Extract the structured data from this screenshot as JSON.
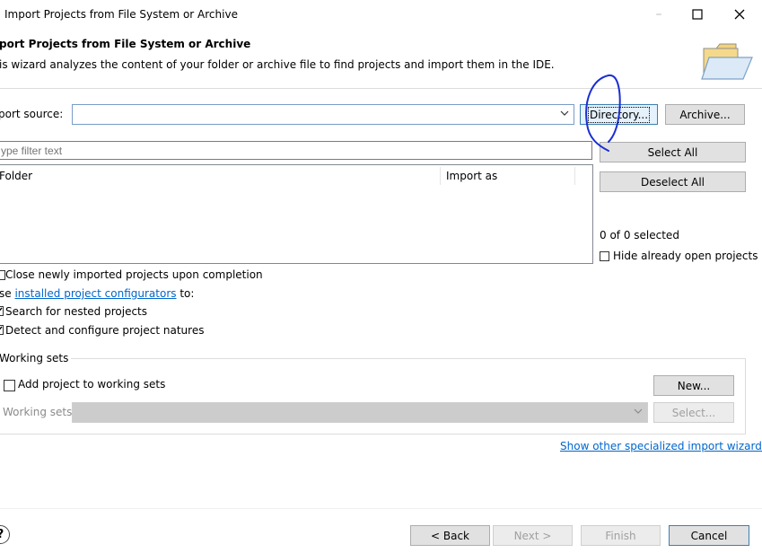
{
  "window": {
    "title": "Import Projects from File System or Archive",
    "minimize_glyph": "–",
    "maximize_glyph": "☐",
    "close_glyph": "✕"
  },
  "wizard": {
    "title": "port Projects from File System or Archive",
    "description": "is wizard analyzes the content of your folder or archive file to find projects and import them in the IDE.",
    "banner_icon": "folder-open-icon"
  },
  "source": {
    "label": "port source:",
    "value": "",
    "directory_button": "Directory...",
    "archive_button": "Archive..."
  },
  "filter": {
    "placeholder": "ype filter text"
  },
  "table": {
    "columns": [
      "Folder",
      "Import as"
    ],
    "rows": []
  },
  "selection": {
    "select_all": "Select All",
    "deselect_all": "Deselect All",
    "count_text": "0 of 0 selected",
    "hide_open": "Hide already open projects"
  },
  "options": {
    "close_imported": "Close newly imported projects upon completion",
    "use_prefix": "se",
    "configurators_link": "installed project configurators",
    "use_suffix": " to:",
    "search_nested": "Search for nested projects",
    "detect_natures": "Detect and configure project natures"
  },
  "working_sets": {
    "group_title": "Working sets",
    "add_label": "Add project to working sets",
    "new_button": "New...",
    "sets_label": "Working sets:",
    "select_button": "Select..."
  },
  "other_wizards_link": "Show other specialized import wizards",
  "footer": {
    "help_glyph": "?",
    "back": "< Back",
    "next": "Next >",
    "finish": "Finish",
    "cancel": "Cancel"
  },
  "colors": {
    "link": "#0066cc",
    "annotation_stroke": "#1a2fd0",
    "focus_border": "#3c7fb1"
  }
}
